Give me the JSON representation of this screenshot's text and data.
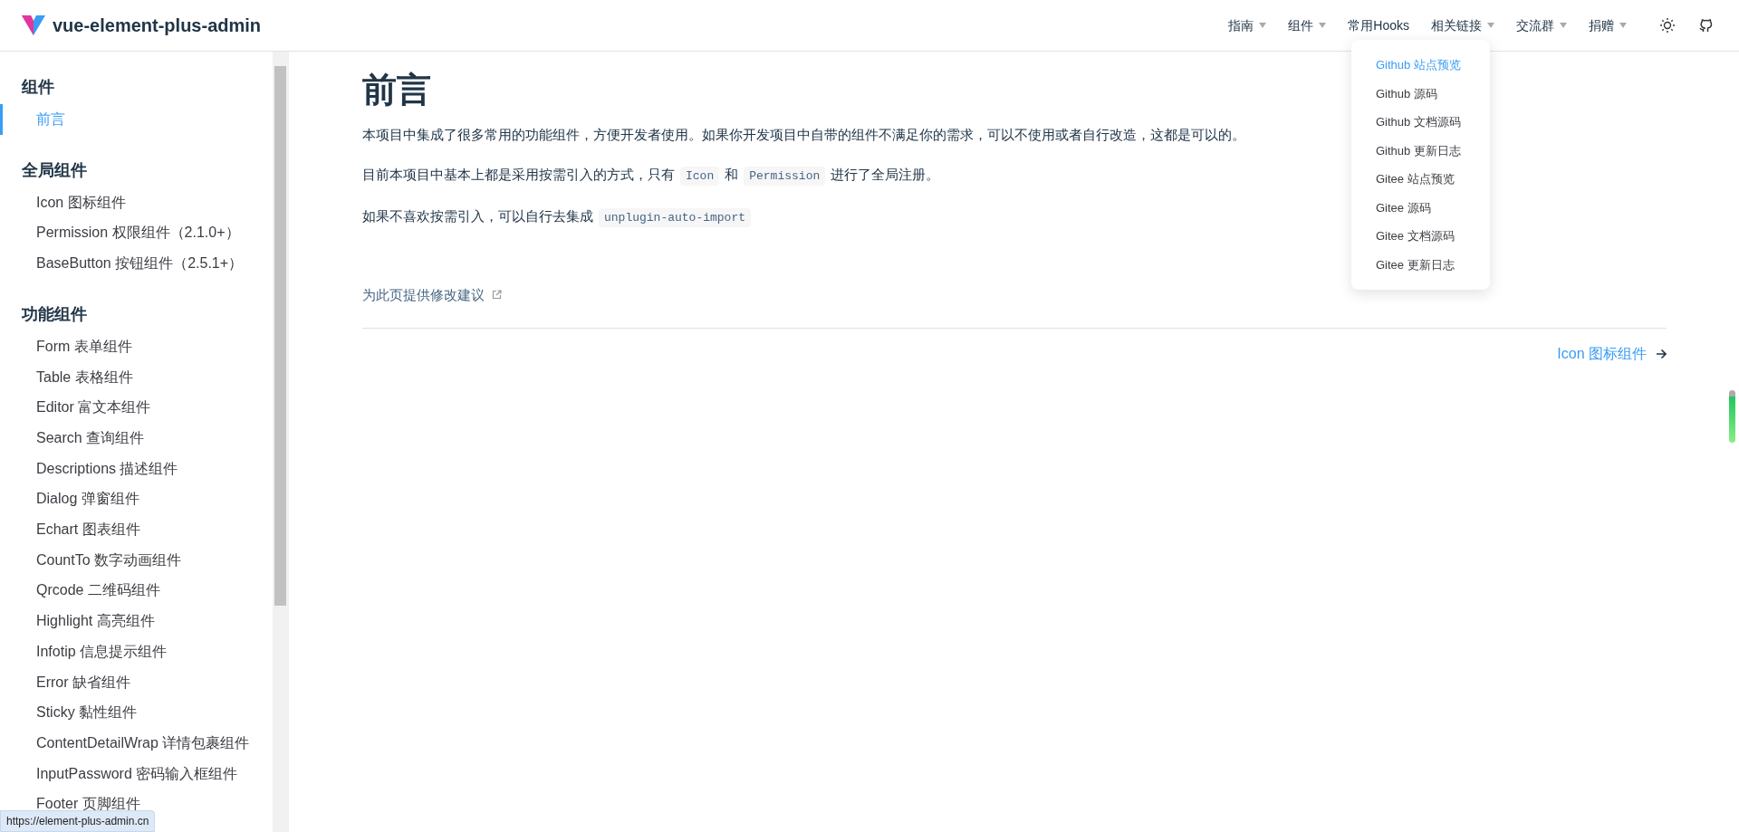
{
  "header": {
    "logo_text": "vue-element-plus-admin",
    "nav": [
      {
        "label": "指南",
        "dropdown": true
      },
      {
        "label": "组件",
        "dropdown": true
      },
      {
        "label": "常用Hooks",
        "dropdown": false
      },
      {
        "label": "相关链接",
        "dropdown": true
      },
      {
        "label": "交流群",
        "dropdown": true
      },
      {
        "label": "捐赠",
        "dropdown": true
      }
    ]
  },
  "open_menu": {
    "items": [
      {
        "label": "Github 站点预览",
        "selected": true
      },
      {
        "label": "Github 源码",
        "selected": false
      },
      {
        "label": "Github 文档源码",
        "selected": false
      },
      {
        "label": "Github 更新日志",
        "selected": false
      },
      {
        "label": "Gitee 站点预览",
        "selected": false
      },
      {
        "label": "Gitee 源码",
        "selected": false
      },
      {
        "label": "Gitee 文档源码",
        "selected": false
      },
      {
        "label": "Gitee 更新日志",
        "selected": false
      }
    ]
  },
  "sidebar": {
    "sections": [
      {
        "title": "组件",
        "items": [
          {
            "label": "前言",
            "selected": true
          }
        ]
      },
      {
        "title": "全局组件",
        "items": [
          {
            "label": "Icon 图标组件",
            "selected": false
          },
          {
            "label": "Permission 权限组件（2.1.0+）",
            "selected": false
          },
          {
            "label": "BaseButton 按钮组件（2.5.1+）",
            "selected": false
          }
        ]
      },
      {
        "title": "功能组件",
        "items": [
          {
            "label": "Form 表单组件",
            "selected": false
          },
          {
            "label": "Table 表格组件",
            "selected": false
          },
          {
            "label": "Editor 富文本组件",
            "selected": false
          },
          {
            "label": "Search 查询组件",
            "selected": false
          },
          {
            "label": "Descriptions 描述组件",
            "selected": false
          },
          {
            "label": "Dialog 弹窗组件",
            "selected": false
          },
          {
            "label": "Echart 图表组件",
            "selected": false
          },
          {
            "label": "CountTo 数字动画组件",
            "selected": false
          },
          {
            "label": "Qrcode 二维码组件",
            "selected": false
          },
          {
            "label": "Highlight 高亮组件",
            "selected": false
          },
          {
            "label": "Infotip 信息提示组件",
            "selected": false
          },
          {
            "label": "Error 缺省组件",
            "selected": false
          },
          {
            "label": "Sticky 黏性组件",
            "selected": false
          },
          {
            "label": "ContentDetailWrap 详情包裹组件",
            "selected": false
          },
          {
            "label": "InputPassword 密码输入框组件",
            "selected": false
          },
          {
            "label": "Footer 页脚组件",
            "selected": false
          }
        ]
      }
    ]
  },
  "article": {
    "title": "前言",
    "paragraphs": [
      [
        {
          "kind": "text",
          "text": "本项目中集成了很多常用的功能组件，方便开发者使用。如果你开发项目中自带的组件不满足你的需求，可以不使用或者自行改造，这都是可以的。"
        }
      ],
      [
        {
          "kind": "text",
          "text": "目前本项目中基本上都是采用按需引入的方式，只有"
        },
        {
          "kind": "code",
          "text": "Icon"
        },
        {
          "kind": "text",
          "text": "和"
        },
        {
          "kind": "code",
          "text": "Permission"
        },
        {
          "kind": "text",
          "text": "进行了全局注册。"
        }
      ],
      [
        {
          "kind": "text",
          "text": "如果不喜欢按需引入，可以自行去集成"
        },
        {
          "kind": "code",
          "text": "unplugin-auto-import"
        }
      ]
    ],
    "edit_link": "为此页提供修改建议",
    "next_link": "Icon 图标组件"
  },
  "status_url": "https://element-plus-admin.cn"
}
